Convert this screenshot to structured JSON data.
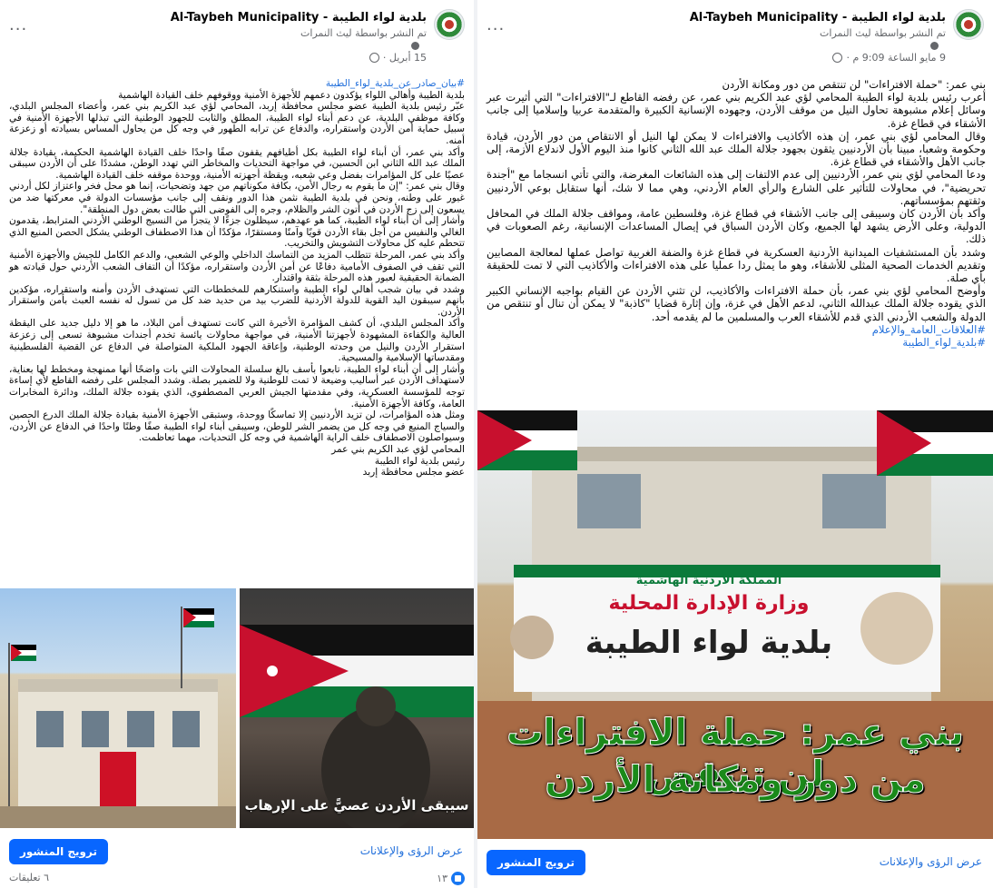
{
  "left_post": {
    "page_name": "بلدية لواء الطيبة - Al-Taybeh Municipality",
    "posted_by": "تم النشر بواسطة ليث النمرات",
    "date": "15 أبريل ·",
    "paragraphs": [
      "#بيان_صادر_عن_بلدية_لواء_الطيبة",
      "بلدية الطيبة وأهالي اللواء يؤكدون دعمهم للأجهزة الأمنية ووقوفهم خلف القيادة الهاشمية",
      "عبّر رئيس بلدية الطيبة عضو مجلس محافظة إربد، المحامي لؤي عبد الكريم بني عمر، وأعضاء المجلس البلدي، وكافة موظفي البلدية، عن دعم أبناء لواء الطيبة، المطلق والثابت للجهود الوطنية التي تبذلها الأجهزة الأمنية في سبيل حماية أمن الأردن واستقراره، والدفاع عن ترابه الطهور في وجه كل من يحاول المساس بسيادته أو زعزعة أمنه.",
      "وأكد بني عمر، أن أبناء لواء الطيبة بكل أطيافهم يقفون صفًا واحدًا خلف القيادة الهاشمية الحكيمة، بقيادة جلالة الملك عبد الله الثاني ابن الحسين، في مواجهة التحديات والمخاطر التي تهدد الوطن، مشددًا على أن الأردن سيبقى عصيًا على كل المؤامرات بفضل وعي شعبه، ويقظة أجهزته الأمنية، ووحدة موقفه خلف القيادة الهاشمية.",
      "وقال بني عمر: \"إن ما يقوم به رجال الأمن، بكافة مكوناتهم من جهد وتضحيات، إنما هو محل فخر واعتزاز لكل أردني غيور على وطنه، ونحن في بلدية الطيبة نثمن هذا الدور ونقف إلى جانب مؤسسات الدولة في معركتها ضد من يسعون إلى زج الأردن في أتون الشر والظلام، وجره إلى الفوضى التي طالت بعض دول المنطقة\".",
      "وأشار إلى أن أبناء لواء الطيبة، كما هو عهدهم، سيظلون جزءًا لا يتجزأ من النسيج الوطني الأردني المترابط، يقدمون الغالي والنفيس من أجل بقاء الأردن قويًا وآمنًا ومستقرًا، مؤكدًا أن هذا الاصطفاف الوطني يشكل الحصن المنيع الذي تتحطم عليه كل محاولات التشويش والتخريب.",
      "وأكد بني عمر، المرحلة تتطلب المزيد من التماسك الداخلي والوعي الشعبي، والدعم الكامل للجيش والأجهزة الأمنية التي تقف في الصفوف الأمامية دفاعًا عن أمن الأردن واستقراره، مؤكدًا أن التفاف الشعب الأردني حول قيادته هو الضمانة الحقيقية لعبور هذه المرحلة بثقة واقتدار.",
      "وشدد في بيان شجب أهالي لواء الطيبة واستنكارهم للمخططات التي تستهدف الأردن وأمنه واستقراره، مؤكدين بأنهم سيبقون اليد القوية للدولة الأردنية للضرب بيد من حديد ضد كل من تسول له نفسه العبث بأمن واستقرار الأردن.",
      "وأكد المجلس البلدي، أن كشف المؤامرة الأخيرة التي كانت تستهدف أمن البلاد، ما هو إلا دليل جديد على اليقظة العالية والكفاءة المشهودة لأجهزتنا الأمنية، في مواجهة محاولات يائسة تخدم أجندات مشبوهة تسعى إلى زعزعة استقرار الأردن والنيل من وحدته الوطنية، وإعاقة الجهود الملكية المتواصلة في الدفاع عن القضية الفلسطينية ومقدساتها الإسلامية والمسيحية.",
      "وأشار إلى أن أبناء لواء الطيبة، تابعوا بأسف بالغ سلسلة المحاولات التي بات واضحًا أنها ممنهجة ومخطط لها بعناية، لاستهداف الأردن عبر أساليب وضيعة لا تمت للوطنية ولا للضمير بصلة. وشدد المجلس على رفضه القاطع لأي إساءة توجه للمؤسسة العسكرية، وفي مقدمتها الجيش العربي المصطفوي، الذي يقوده جلالة الملك، ودائرة المخابرات العامة، وكافة الأجهزة الأمنية.",
      "ومثل هذه المؤامرات، لن تزيد الأردنيين إلا تماسكًا ووحدة، وستبقى الأجهزة الأمنية بقيادة جلالة الملك الدرع الحصين والسياج المنيع في وجه كل من يضمر الشر للوطن، وسيبقى أبناء لواء الطيبة صفًا وطنًا واحدًا في الدفاع عن الأردن، وسيواصلون الاصطفاف خلف الراية الهاشمية في وجه كل التحديات، مهما تعاظمت.",
      "المحامي لؤي عبد الكريم بني عمر",
      "رئيس بلدية لواء الطيبة",
      "عضو مجلس محافظة إربد"
    ],
    "image_caption": "سيبقى الأردن عصيًّ على الإرهاب",
    "promote_label": "ترويج المنشور",
    "insights_label": "عرض الرؤى والإعلانات",
    "reaction_count": "١٣",
    "comments_count": "٦ تعليقات"
  },
  "right_post": {
    "page_name": "بلدية لواء الطيبة - Al-Taybeh Municipality",
    "posted_by": "تم النشر بواسطة ليث النمرات",
    "date": "9 مايو الساعة 9:09 م ·",
    "paragraphs": [
      "بني عمر: \"حملة الافتراءات\" لن تنتقص من دور ومكانة الأردن",
      "أعرب رئيس بلدية لواء الطيبة المحامي لؤي عبد الكريم بني عمر، عن رفضه القاطع لـ\"الافتراءات\" التي أثيرت عبر وسائل إعلام مشبوهة تحاول النيل من موقف الأردن، وجهوده الإنسانية الكبيرة والمتقدمة عربيا وإسلاميا إلى جانب الأشقاء في قطاع غزة.",
      "وقال المحامي لؤي بني عمر، إن هذه الأكاذيب والافتراءات لا يمكن لها النيل أو الانتقاص من دور الأردن، قيادة وحكومة وشعبا، مبينا بأن الأردنيين يثقون بجهود جلالة الملك عبد الله الثاني كانوا منذ اليوم الأول لاندلاع الأزمة، إلى جانب الأهل والأشقاء في قطاع غزة.",
      "ودعا المحامي لؤي بني عمر، الأردنيين إلى عدم الالتفات إلى هذه الشائعات المغرضة، والتي تأتي انسجاما مع \"أجندة تحريضية\"، في محاولات للتأثير على الشارع والرأي العام الأردني، وهي مما لا شك، أنها ستقابل بوعي الأردنيين وثقتهم بمؤسساتهم.",
      "وأكد بأن الأردن كان وسيبقى إلى جانب الأشقاء في قطاع غزة، وفلسطين عامة، ومواقف جلالة الملك في المحافل الدولية، وعلى الأرض يشهد لها الجميع، وكان الأردن السباق في إيصال المساعدات الإنسانية، رغم الصعوبات في ذلك.",
      "وشدد بأن المستشفيات الميدانية الأردنية العسكرية في قطاع غزة والضفة الغربية تواصل عملها لمعالجة المصابين وتقديم الخدمات الصحية المثلى للأشقاء، وهو ما يمثل ردا عمليا على هذه الافتراءات والأكاذيب التي لا تمت للحقيقة بأي صلة.",
      "وأوضح المحامي لؤي بني عمر، بأن حملة الافتراءات والأكاذيب، لن تثني الأردن عن القيام بواجبه الإنساني الكبير الذي يقوده جلالة الملك عبدالله الثاني، لدعم الأهل في غزة، وإن إثارة قضايا \"كاذبة\" لا يمكن أن تنال أو تنتقص من الدولة والشعب الأردني الذي قدم للأشقاء العرب والمسلمين ما لم يقدمه أحد.",
      "#العلاقات_العامة_والإعلام",
      "#بلدية_لواء_الطيبة"
    ],
    "banner_ministry": "وزارة الإدارة المحلية",
    "banner_kingdom": "المملكة الأردنية الهاشمية",
    "banner_municipality": "بلدية لواء الطيبة",
    "overlay_line1": "بني عمر: حملة الافتراءات لن تنتقص",
    "overlay_line2": "من دور ومكانة الأردن",
    "promote_label": "ترويج المنشور",
    "insights_label": "عرض الرؤى والإعلانات"
  },
  "colors": {
    "facebook_blue": "#0866ff",
    "link": "#216fdb",
    "overlay_green": "#1a8a1a",
    "secondary_text": "#65676b"
  }
}
